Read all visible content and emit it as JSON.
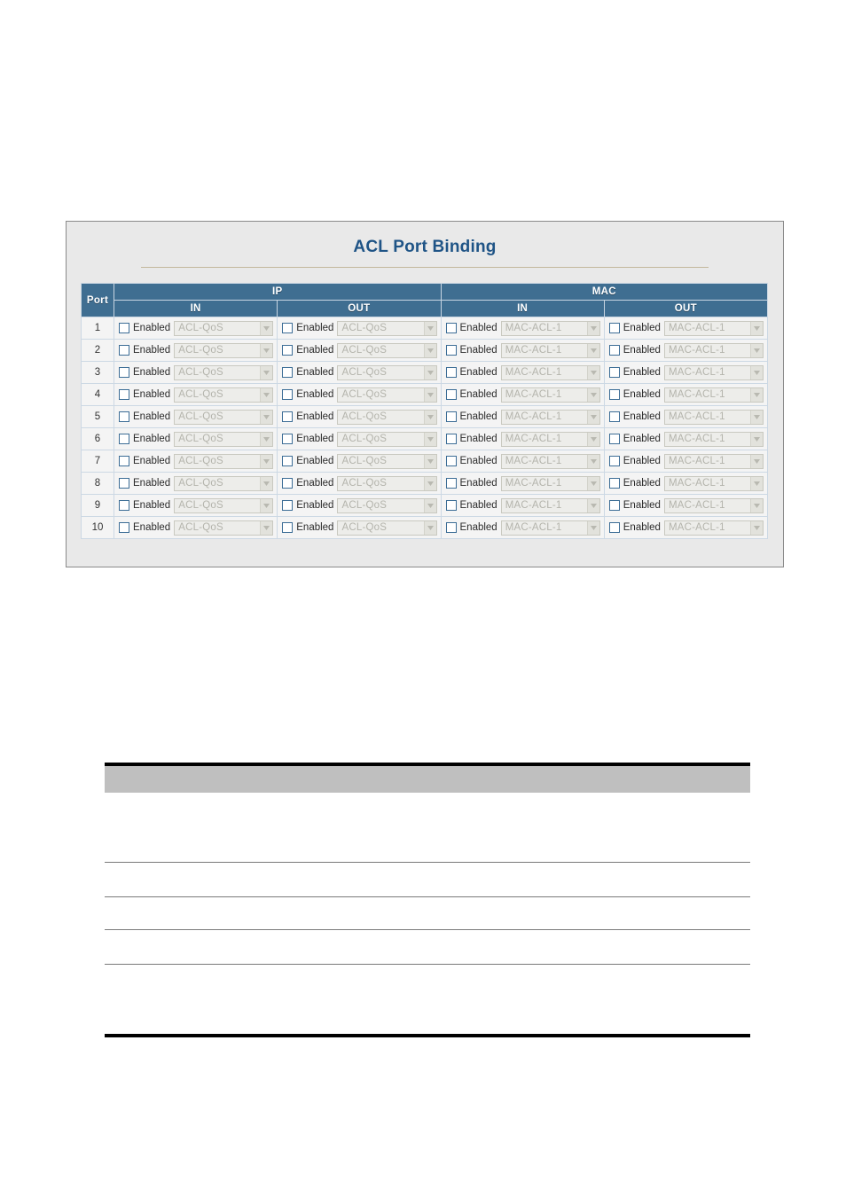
{
  "panel": {
    "title": "ACL Port Binding"
  },
  "table": {
    "group_headers": [
      {
        "label": "Port",
        "colspan": 1
      },
      {
        "label": "IP",
        "colspan": 2
      },
      {
        "label": "MAC",
        "colspan": 2
      }
    ],
    "sub_headers": [
      "",
      "IN",
      "OUT",
      "IN",
      "OUT"
    ],
    "checkbox_label": "Enabled",
    "ip_select_value": "ACL-QoS",
    "mac_select_value": "MAC-ACL-1",
    "rows": [
      {
        "port": "1",
        "ip_in": {
          "enabled": false,
          "acl": "ACL-QoS"
        },
        "ip_out": {
          "enabled": false,
          "acl": "ACL-QoS"
        },
        "mac_in": {
          "enabled": false,
          "acl": "MAC-ACL-1"
        },
        "mac_out": {
          "enabled": false,
          "acl": "MAC-ACL-1"
        }
      },
      {
        "port": "2",
        "ip_in": {
          "enabled": false,
          "acl": "ACL-QoS"
        },
        "ip_out": {
          "enabled": false,
          "acl": "ACL-QoS"
        },
        "mac_in": {
          "enabled": false,
          "acl": "MAC-ACL-1"
        },
        "mac_out": {
          "enabled": false,
          "acl": "MAC-ACL-1"
        }
      },
      {
        "port": "3",
        "ip_in": {
          "enabled": false,
          "acl": "ACL-QoS"
        },
        "ip_out": {
          "enabled": false,
          "acl": "ACL-QoS"
        },
        "mac_in": {
          "enabled": false,
          "acl": "MAC-ACL-1"
        },
        "mac_out": {
          "enabled": false,
          "acl": "MAC-ACL-1"
        }
      },
      {
        "port": "4",
        "ip_in": {
          "enabled": false,
          "acl": "ACL-QoS"
        },
        "ip_out": {
          "enabled": false,
          "acl": "ACL-QoS"
        },
        "mac_in": {
          "enabled": false,
          "acl": "MAC-ACL-1"
        },
        "mac_out": {
          "enabled": false,
          "acl": "MAC-ACL-1"
        }
      },
      {
        "port": "5",
        "ip_in": {
          "enabled": false,
          "acl": "ACL-QoS"
        },
        "ip_out": {
          "enabled": false,
          "acl": "ACL-QoS"
        },
        "mac_in": {
          "enabled": false,
          "acl": "MAC-ACL-1"
        },
        "mac_out": {
          "enabled": false,
          "acl": "MAC-ACL-1"
        }
      },
      {
        "port": "6",
        "ip_in": {
          "enabled": false,
          "acl": "ACL-QoS"
        },
        "ip_out": {
          "enabled": false,
          "acl": "ACL-QoS"
        },
        "mac_in": {
          "enabled": false,
          "acl": "MAC-ACL-1"
        },
        "mac_out": {
          "enabled": false,
          "acl": "MAC-ACL-1"
        }
      },
      {
        "port": "7",
        "ip_in": {
          "enabled": false,
          "acl": "ACL-QoS"
        },
        "ip_out": {
          "enabled": false,
          "acl": "ACL-QoS"
        },
        "mac_in": {
          "enabled": false,
          "acl": "MAC-ACL-1"
        },
        "mac_out": {
          "enabled": false,
          "acl": "MAC-ACL-1"
        }
      },
      {
        "port": "8",
        "ip_in": {
          "enabled": false,
          "acl": "ACL-QoS"
        },
        "ip_out": {
          "enabled": false,
          "acl": "ACL-QoS"
        },
        "mac_in": {
          "enabled": false,
          "acl": "MAC-ACL-1"
        },
        "mac_out": {
          "enabled": false,
          "acl": "MAC-ACL-1"
        }
      },
      {
        "port": "9",
        "ip_in": {
          "enabled": false,
          "acl": "ACL-QoS"
        },
        "ip_out": {
          "enabled": false,
          "acl": "ACL-QoS"
        },
        "mac_in": {
          "enabled": false,
          "acl": "MAC-ACL-1"
        },
        "mac_out": {
          "enabled": false,
          "acl": "MAC-ACL-1"
        }
      },
      {
        "port": "10",
        "ip_in": {
          "enabled": false,
          "acl": "ACL-QoS"
        },
        "ip_out": {
          "enabled": false,
          "acl": "ACL-QoS"
        },
        "mac_in": {
          "enabled": false,
          "acl": "MAC-ACL-1"
        },
        "mac_out": {
          "enabled": false,
          "acl": "MAC-ACL-1"
        }
      }
    ]
  },
  "colors": {
    "header_blue": "#3f6e91",
    "title_blue": "#1f5486",
    "panel_bg": "#e9e9e9",
    "row_bg": "#f4f4f4",
    "band_gray": "#bfbfbf"
  }
}
